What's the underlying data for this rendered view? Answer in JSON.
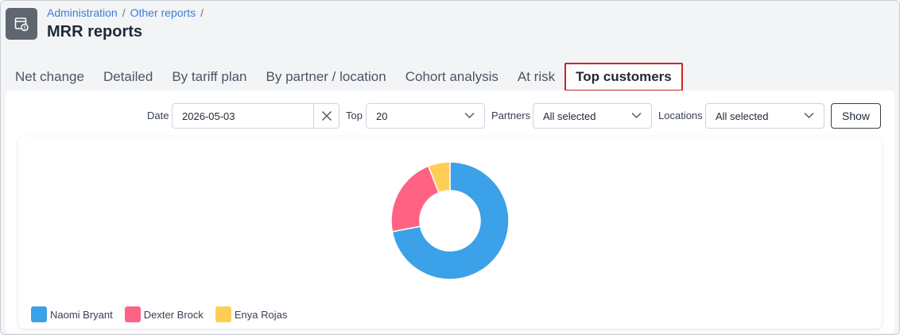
{
  "breadcrumb": {
    "items": [
      "Administration",
      "Other reports"
    ],
    "separator": "/"
  },
  "page": {
    "title": "MRR reports"
  },
  "tabs": [
    {
      "label": "Net change",
      "active": false
    },
    {
      "label": "Detailed",
      "active": false
    },
    {
      "label": "By tariff plan",
      "active": false
    },
    {
      "label": "By partner / location",
      "active": false
    },
    {
      "label": "Cohort analysis",
      "active": false
    },
    {
      "label": "At risk",
      "active": false
    },
    {
      "label": "Top customers",
      "active": true
    }
  ],
  "filters": {
    "date_label": "Date",
    "date_value": "2026-05-03",
    "top_label": "Top",
    "top_value": "20",
    "partners_label": "Partners",
    "partners_value": "All selected",
    "locations_label": "Locations",
    "locations_value": "All selected",
    "show_label": "Show"
  },
  "colors": {
    "accent": "#3b7dd8",
    "active_tab_border": "#c62828"
  },
  "chart_data": {
    "type": "pie",
    "donut": true,
    "legend_position": "bottom-left",
    "categories": [
      "Naomi Bryant",
      "Dexter Brock",
      "Enya Rojas"
    ],
    "values": [
      72,
      22,
      6
    ],
    "colors": [
      "#3ba1e8",
      "#ff6384",
      "#ffcd56"
    ]
  }
}
